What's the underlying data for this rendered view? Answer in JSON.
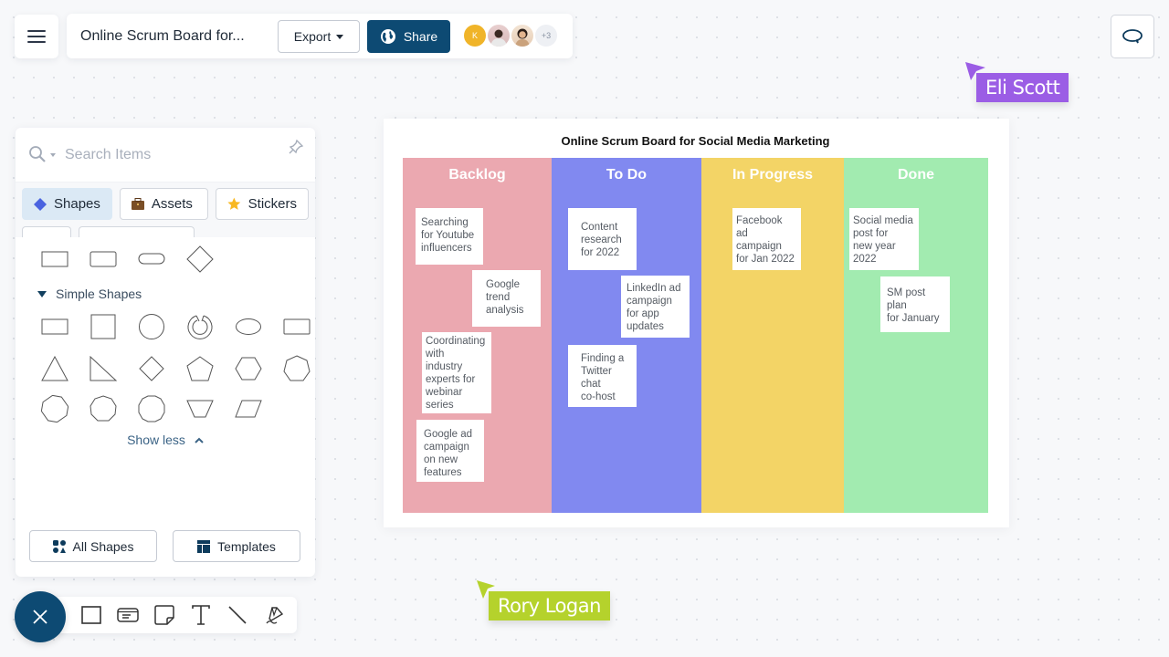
{
  "topbar": {
    "menu_icon": "hamburger-icon",
    "document_title": "Online Scrum Board for...",
    "export_label": "Export",
    "share_label": "Share",
    "share_icon": "globe-icon",
    "collaborators": [
      {
        "initial": "K",
        "color": "#f0b429"
      },
      {
        "initial": "",
        "type": "photo"
      },
      {
        "initial": "",
        "type": "photo"
      }
    ],
    "more_collaborators": "+3"
  },
  "comment_icon": "comment-icon",
  "cursors": [
    {
      "name": "Eli Scott",
      "color": "#9b5de5"
    },
    {
      "name": "Rory Logan",
      "color": "#b5d22c"
    }
  ],
  "panel": {
    "search_placeholder": "Search Items",
    "tabs": [
      {
        "label": "Shapes",
        "icon": "diamond-icon",
        "active": true
      },
      {
        "label": "Assets",
        "icon": "briefcase-icon",
        "active": false
      },
      {
        "label": "Stickers",
        "icon": "star-icon",
        "active": false
      }
    ],
    "section_title": "Simple Shapes",
    "show_less_label": "Show less",
    "footer_buttons": [
      {
        "label": "All Shapes",
        "icon": "grid-icon"
      },
      {
        "label": "Templates",
        "icon": "template-icon"
      }
    ]
  },
  "toolbar": {
    "tools": [
      "rectangle-tool",
      "card-tool",
      "sticky-note-tool",
      "text-tool",
      "line-tool",
      "pen-tool"
    ]
  },
  "board": {
    "title": "Online Scrum Board for Social Media Marketing",
    "columns": [
      {
        "title": "Backlog",
        "color": "#eba8b0",
        "notes": [
          "Searching\nfor Youtube\ninfluencers",
          "Google\ntrend\nanalysis",
          "Coordinating\nwith\nindustry\nexperts for\nwebinar\nseries",
          "Google ad\ncampaign\non new\nfeatures"
        ]
      },
      {
        "title": "To Do",
        "color": "#8189f0",
        "notes": [
          "Content\nresearch\nfor 2022",
          "LinkedIn ad\ncampaign\nfor app\nupdates",
          "Finding a\nTwitter\nchat\nco-host"
        ]
      },
      {
        "title": "In Progress",
        "color": "#f3d466",
        "notes": [
          "Facebook\nad\ncampaign\nfor Jan 2022"
        ]
      },
      {
        "title": "Done",
        "color": "#a2ebb0",
        "notes": [
          "Social media\npost for\nnew year\n2022",
          "SM post\nplan\nfor January"
        ]
      }
    ]
  }
}
